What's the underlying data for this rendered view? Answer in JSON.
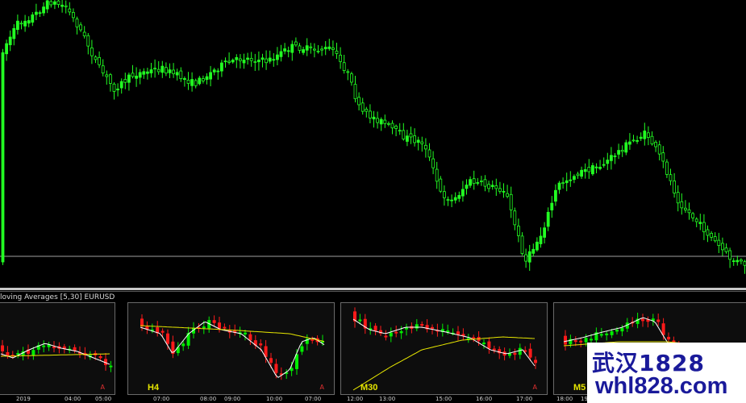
{
  "colors": {
    "bull": "#00ee00",
    "bear": "#ff1a1a",
    "main_candle": "#22ff22",
    "fast_ma": "#ffffff",
    "slow_ma": "#e8e800",
    "hline": "#a0a0a0"
  },
  "indicator": {
    "title": "loving Averages [5,30]  EURUSD"
  },
  "panels": [
    {
      "label": "",
      "marker": "A"
    },
    {
      "label": "H4",
      "marker": "A"
    },
    {
      "label": "M30",
      "marker": "A"
    },
    {
      "label": "M5",
      "marker": ""
    }
  ],
  "time_axis": [
    "2019",
    "04:00",
    "05:00",
    "07:00",
    "08:00",
    "09:00",
    "10:00",
    "07:00",
    "12:00",
    "13:00",
    "15:00",
    "16:00",
    "17:00",
    "18:00",
    "19:00"
  ],
  "watermark": {
    "line1": "武汉1828",
    "line2": "whl828.com"
  }
}
